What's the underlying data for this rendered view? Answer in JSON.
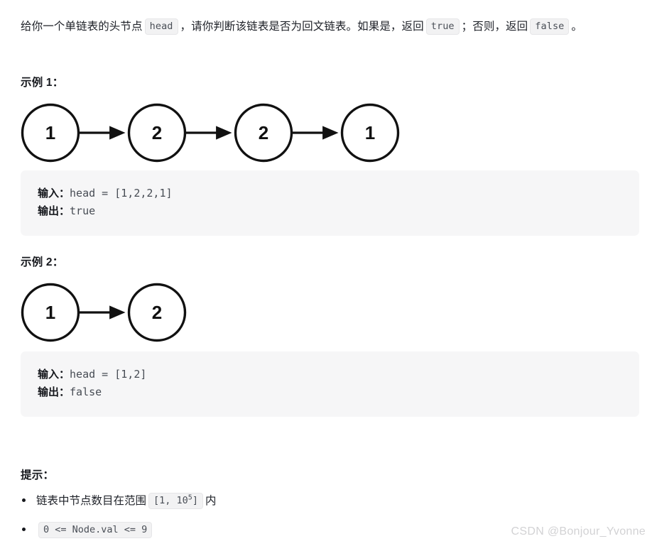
{
  "problem": {
    "intro": {
      "part1": "给你一个单链表的头节点",
      "code1": "head",
      "part2": "，请你判断该链表是否为回文链表。如果是，返回",
      "code2": "true",
      "part3": "；否则，返回",
      "code3": "false",
      "part4": "。"
    }
  },
  "examples": [
    {
      "title": "示例 1：",
      "diagram": {
        "type": "linked-list",
        "nodes": [
          "1",
          "2",
          "2",
          "1"
        ],
        "node_diameter": 80,
        "node_gap": 70,
        "stroke_color": "#111111"
      },
      "input_label": "输入：",
      "input_value": "head = [1,2,2,1]",
      "output_label": "输出：",
      "output_value": "true"
    },
    {
      "title": "示例 2：",
      "diagram": {
        "type": "linked-list",
        "nodes": [
          "1",
          "2"
        ],
        "node_diameter": 80,
        "node_gap": 70,
        "stroke_color": "#111111"
      },
      "input_label": "输入：",
      "input_value": "head = [1,2]",
      "output_label": "输出：",
      "output_value": "false"
    }
  ],
  "hints": {
    "title": "提示：",
    "items": [
      {
        "prefix": "链表中节点数目在范围",
        "code_base": "[1, 10",
        "code_exp": "5",
        "code_tail": "]",
        "suffix": "内"
      },
      {
        "prefix": "",
        "code_plain": "0 <= Node.val <= 9",
        "suffix": ""
      }
    ]
  },
  "watermark": {
    "text": "CSDN @Bonjour_Yvonne"
  },
  "colors": {
    "page_background": "#ffffff",
    "code_block_background": "#f6f6f7",
    "inline_code_background": "#f2f2f3",
    "text": "#20232a",
    "watermark": "#d2d2d4"
  }
}
